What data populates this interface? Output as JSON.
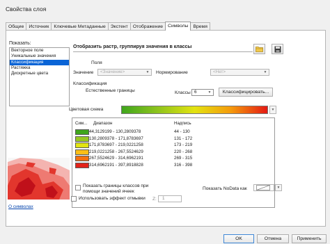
{
  "window": {
    "title": "Свойства слоя"
  },
  "tabs": [
    {
      "label": "Общие",
      "active": false
    },
    {
      "label": "Источник",
      "active": false
    },
    {
      "label": "Ключевые Метаданные",
      "active": false
    },
    {
      "label": "Экстент",
      "active": false
    },
    {
      "label": "Отображение",
      "active": false
    },
    {
      "label": "Символы",
      "active": true
    },
    {
      "label": "Время",
      "active": false
    }
  ],
  "show": {
    "label": "Показать:",
    "items": [
      "Векторное поле",
      "Уникальные значения",
      "Классификация",
      "Растяжка",
      "Дискретные цвета"
    ],
    "selected_index": 2
  },
  "about_link": "О символах",
  "main": {
    "headline": "Отобразить растр, группируя значения в классы",
    "field_group": "Поля",
    "value_label": "Значение",
    "value_combo": "<Значение>",
    "normalization_label": "Нормирование",
    "normalization_combo": "<Нет>",
    "classification_group": "Классификация",
    "method_label": "Естественные границы",
    "classes_label": "Классы",
    "classes_value": "6",
    "classify_button": "Классифицировать...",
    "color_ramp_label": "Цветовая схема",
    "table_headers": {
      "symbol": "Сим...",
      "range": "Диапазон",
      "label": "Надпись"
    },
    "classes": [
      {
        "color": "#3fa61c",
        "range": "44,3129199 - 130,2809378",
        "label": "44 - 130"
      },
      {
        "color": "#98c822",
        "range": "130,2809378 - 171,8783697",
        "label": "131 - 172"
      },
      {
        "color": "#e2e412",
        "range": "171,8783697 - 219,0221258",
        "label": "173 - 219"
      },
      {
        "color": "#fbbf16",
        "range": "219,0221258 - 267,5524629",
        "label": "220 - 268"
      },
      {
        "color": "#f5710f",
        "range": "267,5524629 - 314,6962191",
        "label": "269 - 315"
      },
      {
        "color": "#e2231a",
        "range": "314,6962191 - 397,8918828",
        "label": "316 - 398"
      }
    ],
    "show_boundaries_text": "Показать границы классов при помощи значений ячеек",
    "nodata_label": "Показать NoData как",
    "hillshade_text": "Использовать эффект отмывки",
    "hillshade_z_label": "Z:",
    "hillshade_z_value": "1"
  },
  "footer": {
    "ok": "OK",
    "cancel": "Отмена",
    "apply": "Применить"
  },
  "colors": {
    "accent": "#0a64d6",
    "link": "#0645ad"
  }
}
